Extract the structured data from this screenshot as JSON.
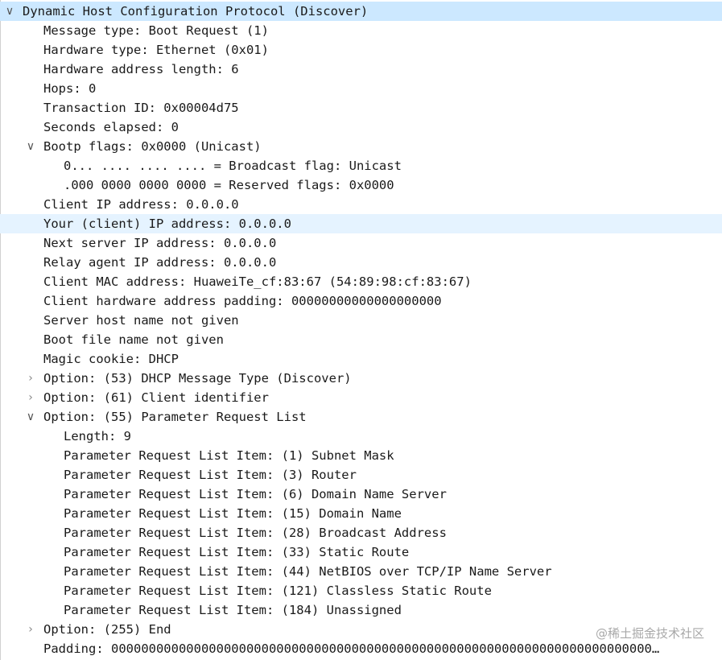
{
  "rows": [
    {
      "text": "Dynamic Host Configuration Protocol (Discover)",
      "level": 0,
      "toggle": "expanded",
      "state": "selected",
      "name": "tree-node-dhcp"
    },
    {
      "text": "Message type: Boot Request (1)",
      "level": 1,
      "name": "field-message-type"
    },
    {
      "text": "Hardware type: Ethernet (0x01)",
      "level": 1,
      "name": "field-hardware-type"
    },
    {
      "text": "Hardware address length: 6",
      "level": 1,
      "name": "field-hardware-address-length"
    },
    {
      "text": "Hops: 0",
      "level": 1,
      "name": "field-hops"
    },
    {
      "text": "Transaction ID: 0x00004d75",
      "level": 1,
      "name": "field-transaction-id"
    },
    {
      "text": "Seconds elapsed: 0",
      "level": 1,
      "name": "field-seconds-elapsed"
    },
    {
      "text": "Bootp flags: 0x0000 (Unicast)",
      "level": 1,
      "toggle": "expanded",
      "name": "tree-node-bootp-flags"
    },
    {
      "text": "0... .... .... .... = Broadcast flag: Unicast",
      "level": 2,
      "name": "field-broadcast-flag"
    },
    {
      "text": ".000 0000 0000 0000 = Reserved flags: 0x0000",
      "level": 2,
      "name": "field-reserved-flags"
    },
    {
      "text": "Client IP address: 0.0.0.0",
      "level": 1,
      "name": "field-client-ip"
    },
    {
      "text": "Your (client) IP address: 0.0.0.0",
      "level": 1,
      "state": "hover",
      "name": "field-your-ip"
    },
    {
      "text": "Next server IP address: 0.0.0.0",
      "level": 1,
      "name": "field-next-server-ip"
    },
    {
      "text": "Relay agent IP address: 0.0.0.0",
      "level": 1,
      "name": "field-relay-agent-ip"
    },
    {
      "text": "Client MAC address: HuaweiTe_cf:83:67 (54:89:98:cf:83:67)",
      "level": 1,
      "name": "field-client-mac"
    },
    {
      "text": "Client hardware address padding: 00000000000000000000",
      "level": 1,
      "name": "field-client-hw-padding"
    },
    {
      "text": "Server host name not given",
      "level": 1,
      "name": "field-server-host-name"
    },
    {
      "text": "Boot file name not given",
      "level": 1,
      "name": "field-boot-file-name"
    },
    {
      "text": "Magic cookie: DHCP",
      "level": 1,
      "name": "field-magic-cookie"
    },
    {
      "text": "Option: (53) DHCP Message Type (Discover)",
      "level": 1,
      "toggle": "collapsed",
      "name": "tree-node-option-53"
    },
    {
      "text": "Option: (61) Client identifier",
      "level": 1,
      "toggle": "collapsed",
      "name": "tree-node-option-61"
    },
    {
      "text": "Option: (55) Parameter Request List",
      "level": 1,
      "toggle": "expanded",
      "name": "tree-node-option-55"
    },
    {
      "text": "Length: 9",
      "level": 2,
      "name": "field-option-length"
    },
    {
      "text": "Parameter Request List Item: (1) Subnet Mask",
      "level": 2,
      "name": "param-item-subnet-mask"
    },
    {
      "text": "Parameter Request List Item: (3) Router",
      "level": 2,
      "name": "param-item-router"
    },
    {
      "text": "Parameter Request List Item: (6) Domain Name Server",
      "level": 2,
      "name": "param-item-dns"
    },
    {
      "text": "Parameter Request List Item: (15) Domain Name",
      "level": 2,
      "name": "param-item-domain-name"
    },
    {
      "text": "Parameter Request List Item: (28) Broadcast Address",
      "level": 2,
      "name": "param-item-broadcast-address"
    },
    {
      "text": "Parameter Request List Item: (33) Static Route",
      "level": 2,
      "name": "param-item-static-route"
    },
    {
      "text": "Parameter Request List Item: (44) NetBIOS over TCP/IP Name Server",
      "level": 2,
      "name": "param-item-netbios-ns"
    },
    {
      "text": "Parameter Request List Item: (121) Classless Static Route",
      "level": 2,
      "name": "param-item-classless-static-route"
    },
    {
      "text": "Parameter Request List Item: (184) Unassigned",
      "level": 2,
      "name": "param-item-unassigned"
    },
    {
      "text": "Option: (255) End",
      "level": 1,
      "toggle": "collapsed",
      "name": "tree-node-option-255"
    },
    {
      "text": "Padding: 000000000000000000000000000000000000000000000000000000000000000000000000…",
      "level": 1,
      "name": "field-padding"
    }
  ],
  "icons": {
    "expanded": "chevron-down-icon",
    "collapsed": "chevron-right-icon"
  },
  "colors": {
    "selected_row": "#cce8ff",
    "hover_row": "#e5f3ff",
    "text": "#1a1a1a"
  },
  "watermark": "@稀土掘金技术社区"
}
